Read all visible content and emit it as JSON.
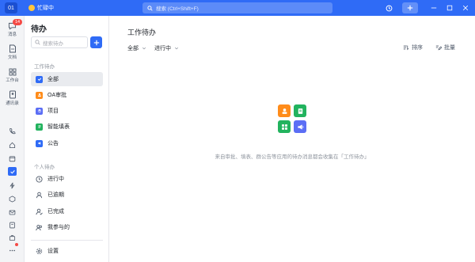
{
  "titlebar": {
    "avatar_text": "01",
    "status_text": "忙碌中",
    "search_placeholder": "搜索 (Ctrl+Shift+F)"
  },
  "rail": {
    "items": [
      {
        "label": "消息",
        "badge": "14"
      },
      {
        "label": "文档"
      },
      {
        "label": "工作台"
      },
      {
        "label": "通讯录"
      }
    ]
  },
  "sidebar": {
    "title": "待办",
    "search_placeholder": "搜索待办",
    "section_work": "工作待办",
    "work_items": [
      {
        "label": "全部",
        "icon": "checkbox-icon",
        "color": "#2f6bf6"
      },
      {
        "label": "OA审批",
        "icon": "approval-icon",
        "color": "#ff8c1a"
      },
      {
        "label": "项目",
        "icon": "project-icon",
        "color": "#5b6ef5"
      },
      {
        "label": "智能填表",
        "icon": "form-icon",
        "color": "#22b35e"
      },
      {
        "label": "公告",
        "icon": "announcement-icon",
        "color": "#2f6bf6"
      }
    ],
    "section_personal": "个人待办",
    "personal_items": [
      {
        "label": "进行中",
        "icon": "clock-icon"
      },
      {
        "label": "已逾期",
        "icon": "person-icon"
      },
      {
        "label": "已完成",
        "icon": "person-check-icon"
      },
      {
        "label": "我参与的",
        "icon": "people-icon"
      }
    ],
    "settings_label": "设置"
  },
  "main": {
    "title": "工作待办",
    "filter_all": "全部",
    "filter_status": "进行中",
    "sort_label": "排序",
    "batch_label": "批量",
    "empty_text": "来自审批、填表、群公告等应用的待办消息都会收集在「工作待办」"
  },
  "colors": {
    "accent": "#2f6bf6",
    "orange": "#ff8c1a",
    "green": "#22b35e",
    "indigo": "#5b6ef5",
    "badge_red": "#f54a45"
  }
}
